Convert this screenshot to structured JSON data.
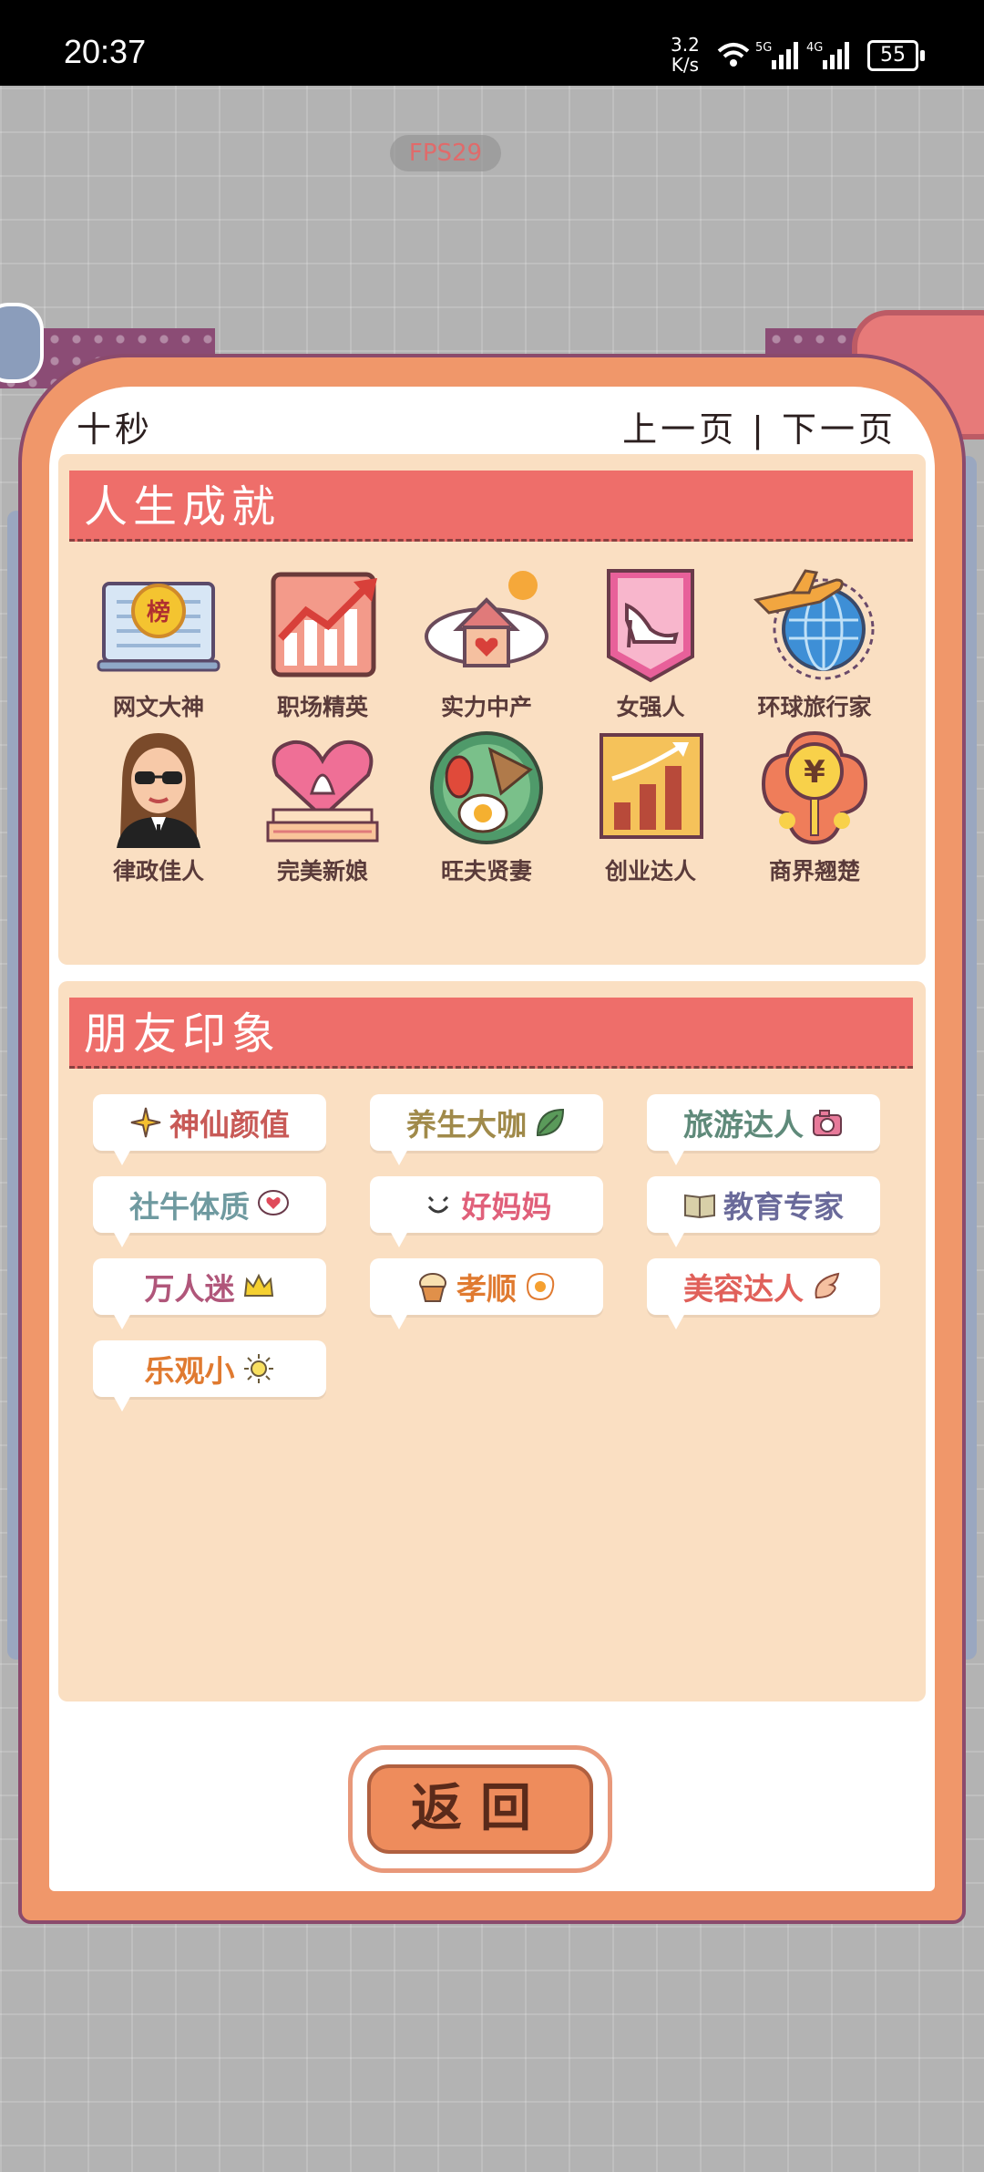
{
  "status_bar": {
    "time": "20:37",
    "net_speed_value": "3.2",
    "net_speed_unit": "K/s",
    "battery": "55"
  },
  "fps": "FPS29",
  "header": {
    "title": "十秒",
    "prev_page": "上一页",
    "separator": "|",
    "next_page": "下一页"
  },
  "achievements": {
    "title": "人生成就",
    "items": [
      {
        "label": "网文大神",
        "icon": "book-badge-icon"
      },
      {
        "label": "职场精英",
        "icon": "rising-chart-icon"
      },
      {
        "label": "实力中产",
        "icon": "house-cloud-icon"
      },
      {
        "label": "女强人",
        "icon": "high-heel-icon"
      },
      {
        "label": "环球旅行家",
        "icon": "globe-plane-icon"
      },
      {
        "label": "律政佳人",
        "icon": "sunglasses-woman-icon"
      },
      {
        "label": "完美新娘",
        "icon": "heart-cake-icon"
      },
      {
        "label": "旺夫贤妻",
        "icon": "plate-food-icon"
      },
      {
        "label": "创业达人",
        "icon": "bar-growth-icon"
      },
      {
        "label": "商界翘楚",
        "icon": "yuan-coin-icon"
      }
    ]
  },
  "friends": {
    "title": "朋友印象",
    "tags": [
      {
        "label": "神仙颜值",
        "color": "#c85a57",
        "icon": "sparkle-icon"
      },
      {
        "label": "养生大咖",
        "color": "#a08a4a",
        "icon": "leaf-icon"
      },
      {
        "label": "旅游达人",
        "color": "#5f8a7a",
        "icon": "camera-icon"
      },
      {
        "label": "社牛体质",
        "color": "#6f9aa0",
        "icon": "heart-bubble-icon"
      },
      {
        "label": "好妈妈",
        "color": "#e0607a",
        "icon": "smile-icon"
      },
      {
        "label": "教育专家",
        "color": "#6a6a9a",
        "icon": "open-book-icon"
      },
      {
        "label": "万人迷",
        "color": "#b0567a",
        "icon": "crown-icon"
      },
      {
        "label": "孝顺",
        "color": "#e07a30",
        "icon": "cupcake-icon"
      },
      {
        "label": "美容达人",
        "color": "#e0605a",
        "icon": "wing-icon"
      },
      {
        "label": "乐观小",
        "color": "#e07a30",
        "icon": "sun-icon"
      }
    ]
  },
  "back_button": "返回"
}
